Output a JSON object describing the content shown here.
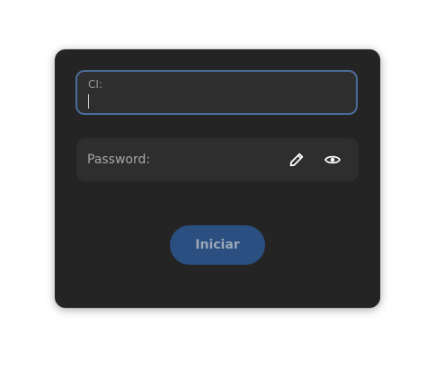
{
  "form": {
    "ci_label": "CI:",
    "ci_value": "",
    "password_label": "Password:",
    "edit_icon": "pencil-icon",
    "visibility_icon": "eye-icon",
    "start_label": "Iniciar"
  },
  "colors": {
    "window_bg": "#242424",
    "entry_bg": "#2e2e2e",
    "focus_border": "#4a6d9c",
    "accent_button": "#2a4f80"
  }
}
